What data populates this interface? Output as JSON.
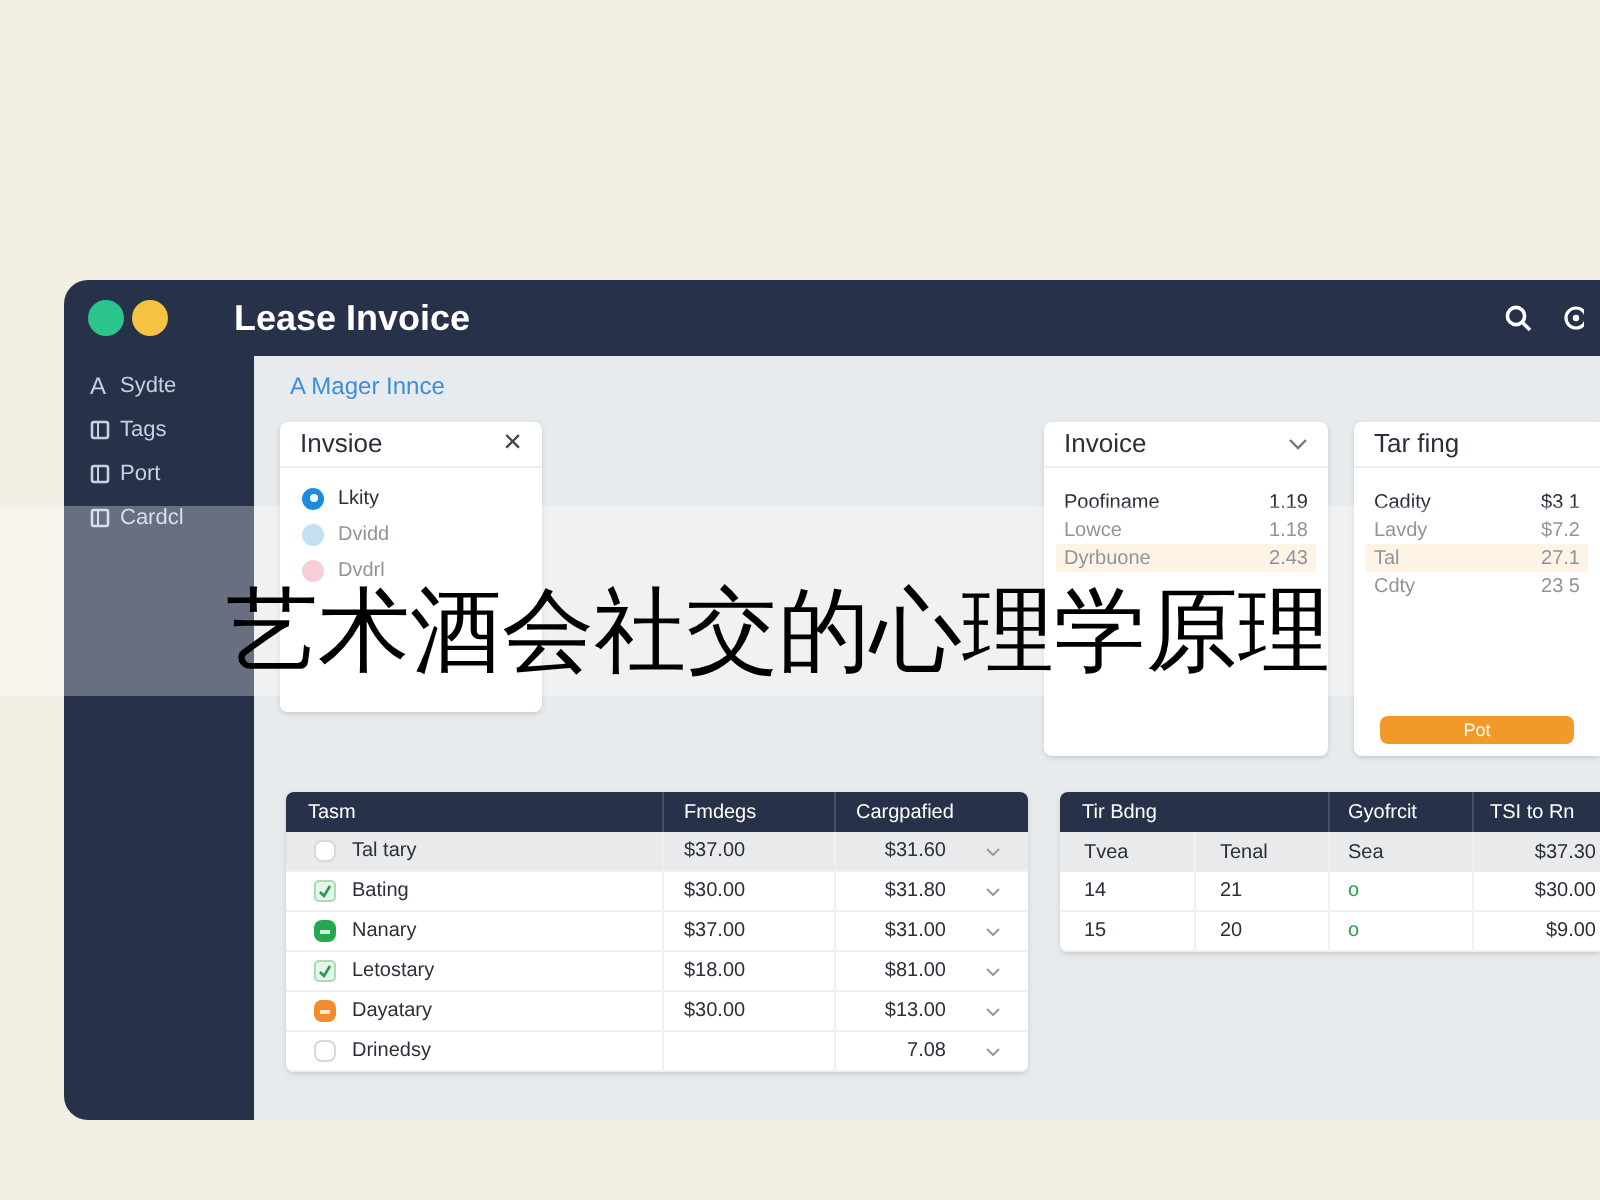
{
  "window": {
    "title": "Lease Invoice",
    "dots": [
      {
        "color": "#2bc48a"
      },
      {
        "color": "#f5c242"
      }
    ]
  },
  "sidebar": {
    "items": [
      {
        "label": "Sydte",
        "glyph": "A"
      },
      {
        "label": "Tags"
      },
      {
        "label": "Port"
      },
      {
        "label": "Cardcl"
      }
    ]
  },
  "breadcrumb": "A Mager Innce",
  "invoice_panel": {
    "title": "Invsioe",
    "close": "×",
    "options": [
      {
        "label": "Lkity",
        "color": "#1d8ce0",
        "selected": true
      },
      {
        "label": "Dvidd",
        "color": "#c3e0f5",
        "selected": false
      },
      {
        "label": "Dvdrl",
        "color": "#f7cdd6",
        "selected": false
      }
    ]
  },
  "invoice_card": {
    "title": "Invoice",
    "rows": [
      {
        "label": "Poofiname",
        "value": "1.19",
        "selected": false
      },
      {
        "label": "Lowce",
        "value": "1.18",
        "selected": false
      },
      {
        "label": "Dyrbuone",
        "value": "2.43",
        "selected": true
      }
    ]
  },
  "tariff_card": {
    "title": "Tar fing",
    "rows": [
      {
        "label": "Cadity",
        "value": "$3 1",
        "selected": false
      },
      {
        "label": "Lavdy",
        "value": "$7.2",
        "selected": false
      },
      {
        "label": "Tal",
        "value": "27.1",
        "selected": true
      },
      {
        "label": "Cdty",
        "value": "23 5",
        "selected": false
      }
    ],
    "button": "Pot"
  },
  "table": {
    "columns": [
      "Tasm",
      "Fmdegs",
      "Cargpafied"
    ],
    "rows": [
      {
        "kind": "empty",
        "name": "Tal tary",
        "col2": "$37.00",
        "col3": "$31.60",
        "selected": true
      },
      {
        "kind": "tick",
        "name": "Bating",
        "col2": "$30.00",
        "col3": "$31.80",
        "selected": false
      },
      {
        "kind": "solid",
        "color": "#22a84f",
        "name": "Nanary",
        "col2": "$37.00",
        "col3": "$31.00",
        "selected": false
      },
      {
        "kind": "tick",
        "name": "Letostary",
        "col2": "$18.00",
        "col3": "$81.00",
        "selected": false
      },
      {
        "kind": "solid",
        "color": "#f08c2a",
        "name": "Dayatary",
        "col2": "$30.00",
        "col3": "$13.00",
        "selected": false
      },
      {
        "kind": "empty",
        "name": "Drinedsy",
        "col3": "7.08",
        "selected": false
      }
    ]
  },
  "table_2": {
    "column_groups": [
      "Tir Bdng",
      "Gyofrcit",
      "TSI to Rn"
    ],
    "columns": [
      "Tvea",
      "Tenal",
      "Sea",
      "$37.30"
    ],
    "rows": [
      [
        "14",
        "21",
        "o",
        "$30.00"
      ],
      [
        "15",
        "20",
        "o",
        "$9.00"
      ]
    ]
  },
  "banner": "艺术酒会社交的心理学原理"
}
